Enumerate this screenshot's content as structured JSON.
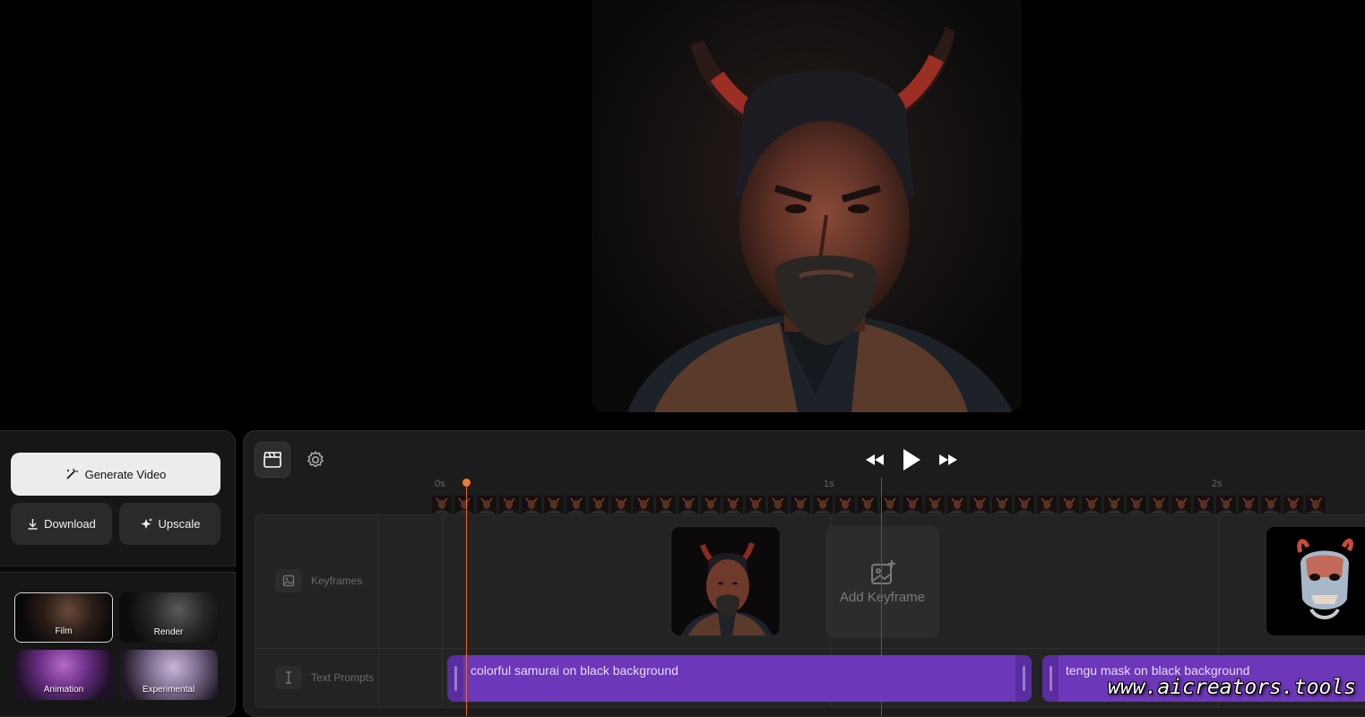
{
  "preview": {
    "alt": "samurai portrait preview",
    "icon": "samurai-portrait-image"
  },
  "actions": {
    "generate_label": "Generate Video",
    "download_label": "Download",
    "upscale_label": "Upscale"
  },
  "styles": [
    {
      "label": "Film",
      "selected": true
    },
    {
      "label": "Render",
      "selected": false
    },
    {
      "label": "Animation",
      "selected": false
    },
    {
      "label": "Experimental",
      "selected": false
    }
  ],
  "ruler": {
    "labels": [
      "0s",
      "1s",
      "2s"
    ]
  },
  "tracks": {
    "keyframes_label": "Keyframes",
    "prompts_label": "Text Prompts",
    "add_keyframe_label": "Add Keyframe"
  },
  "prompts": [
    {
      "text": "colorful samurai on black background"
    },
    {
      "text": "tengu mask on black background"
    }
  ],
  "watermark": "www.aicreators.tools",
  "colors": {
    "accent": "#6c37b8",
    "playhead": "#f07a34",
    "panel": "#1c1c1c"
  }
}
